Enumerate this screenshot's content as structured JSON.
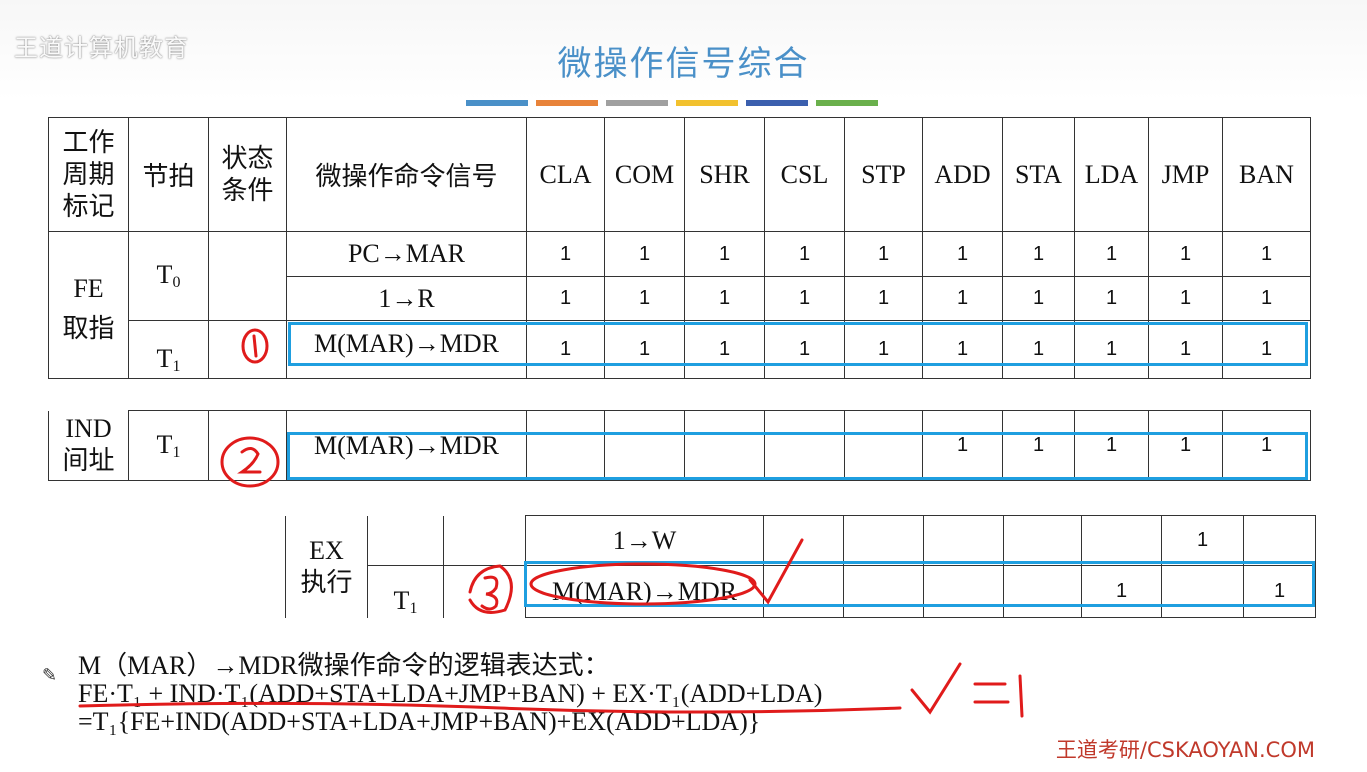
{
  "watermark": "王道计算机教育",
  "title": "微操作信号综合",
  "accent_colors": [
    "#4a90c8",
    "#e8833a",
    "#a0a0a0",
    "#f2c12e",
    "#3b5fae",
    "#6ab04c"
  ],
  "table": {
    "headers": {
      "cycle": "工作周期标记",
      "beat": "节拍",
      "cond": "状态条件",
      "signal": "微操作命令信号",
      "instructions": [
        "CLA",
        "COM",
        "SHR",
        "CSL",
        "STP",
        "ADD",
        "STA",
        "LDA",
        "JMP",
        "BAN"
      ]
    },
    "fe_cycle": [
      "FE",
      "取指"
    ],
    "t0": "T",
    "t0_sub": "0",
    "t1": "T",
    "t1_sub": "1",
    "fe_rows": [
      {
        "signal": "PC→MAR",
        "values": [
          "1",
          "1",
          "1",
          "1",
          "1",
          "1",
          "1",
          "1",
          "1",
          "1"
        ]
      },
      {
        "signal": "1→R",
        "values": [
          "1",
          "1",
          "1",
          "1",
          "1",
          "1",
          "1",
          "1",
          "1",
          "1"
        ]
      },
      {
        "signal": "M(MAR)→MDR",
        "values": [
          "1",
          "1",
          "1",
          "1",
          "1",
          "1",
          "1",
          "1",
          "1",
          "1"
        ]
      }
    ],
    "ind_cycle": [
      "IND",
      "间址"
    ],
    "ind_row": {
      "signal": "M(MAR)→MDR",
      "values": [
        "",
        "",
        "",
        "",
        "",
        "1",
        "1",
        "1",
        "1",
        "1"
      ]
    },
    "ex_cycle": [
      "EX",
      "执行"
    ],
    "ex_rows": [
      {
        "signal": "1→W",
        "values": [
          "",
          "",
          "",
          "",
          "",
          "1",
          "",
          "",
          ""
        ]
      },
      {
        "signal": "M(MAR)→MDR",
        "values": [
          "",
          "",
          "",
          "",
          "1",
          "",
          "1",
          "",
          ""
        ]
      }
    ]
  },
  "formula": {
    "line1": "M（MAR）→MDR微操作命令的逻辑表达式：",
    "line2": "FE·T₁ + IND·T₁(ADD+STA+LDA+JMP+BAN) + EX·T₁(ADD+LDA)",
    "line3": "=T₁{FE+IND(ADD+STA+LDA+JMP+BAN)+EX(ADD+LDA)}"
  },
  "footer": "王道考研/CSKAOYAN.COM"
}
